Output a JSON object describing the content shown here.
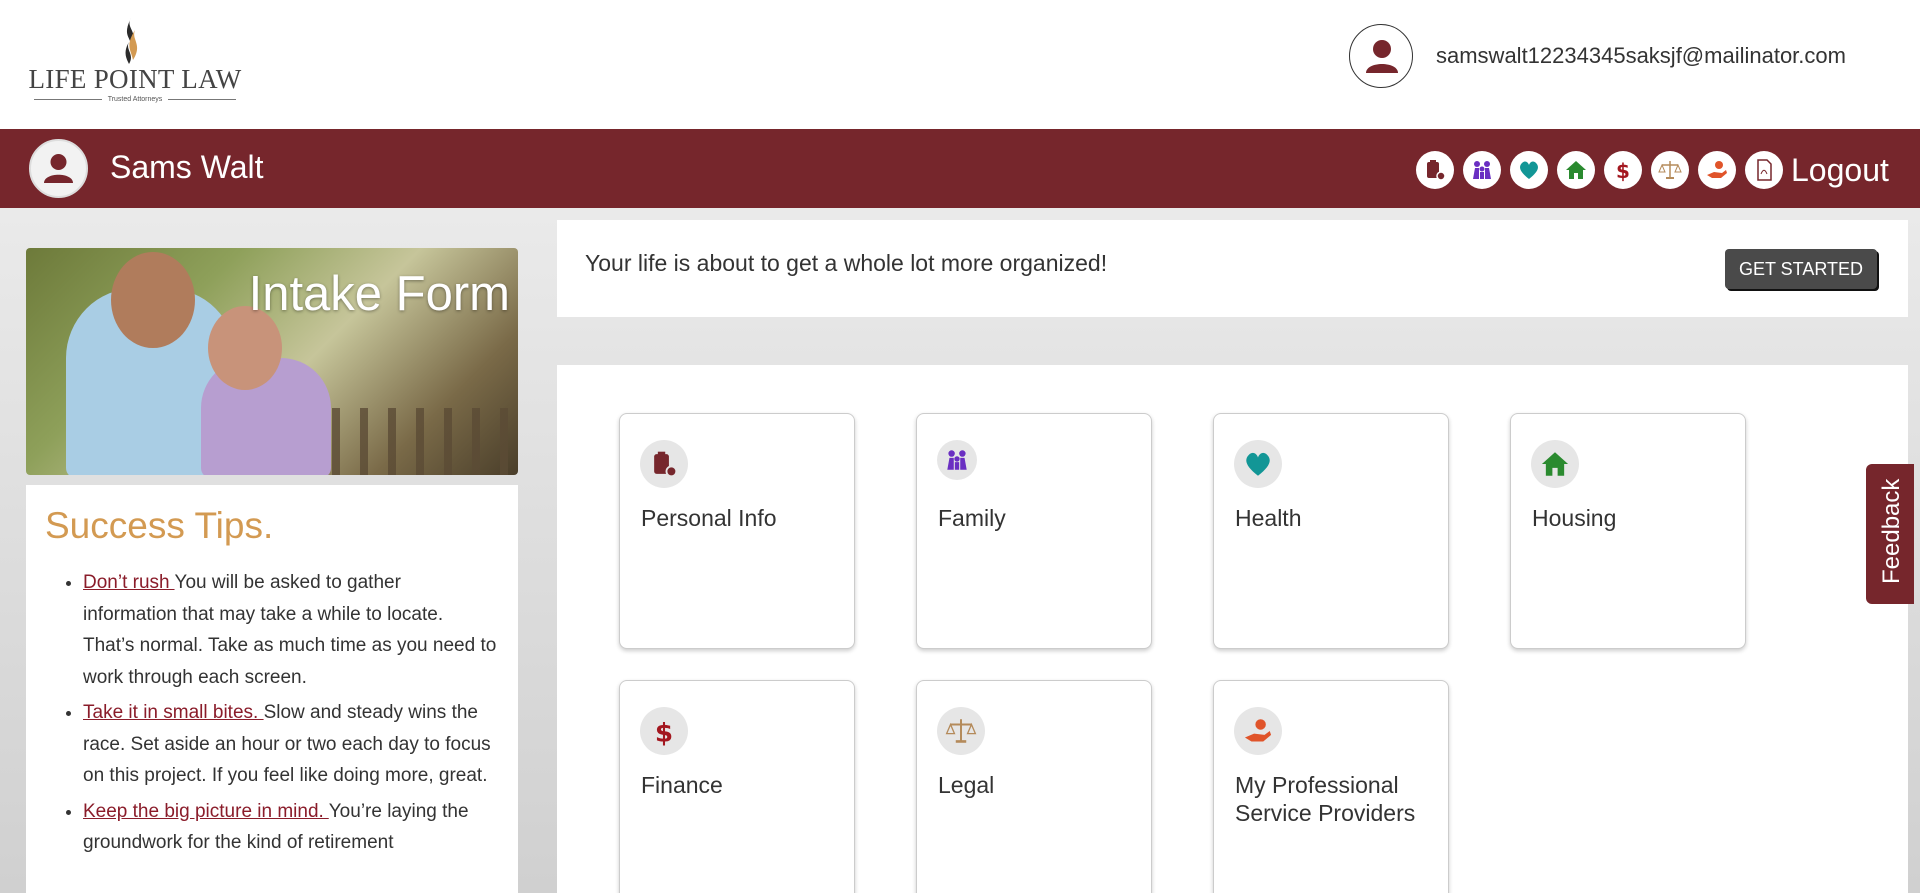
{
  "header": {
    "logo_text": "LIFE POINT LAW",
    "logo_tagline": "Trusted Attorneys",
    "email": "samswalt12234345saksjf@mailinator.com"
  },
  "navbar": {
    "user_name": "Sams Walt",
    "logout_label": "Logout",
    "icons": [
      "clipboard-gear-icon",
      "family-icon",
      "heart-icon",
      "house-icon",
      "dollar-icon",
      "scales-icon",
      "hand-gear-icon",
      "pdf-icon"
    ]
  },
  "hero": {
    "title": "Intake Form"
  },
  "tips": {
    "heading": "Success Tips.",
    "items": [
      {
        "link": "Don’t rush ",
        "text": "You will be asked to gather information that may take a while to locate. That’s normal. Take as much time as you need to work through each screen."
      },
      {
        "link": "Take it in small bites. ",
        "text": "Slow and steady wins the race. Set aside an hour or two each day to focus on this project. If you feel like doing more, great."
      },
      {
        "link": "Keep the big picture in mind. ",
        "text": "You’re laying the groundwork for the kind of retirement"
      }
    ]
  },
  "welcome": {
    "message": "Your life is about to get a whole lot more organized!",
    "button": "GET STARTED"
  },
  "cards": [
    {
      "label": "Personal Info",
      "icon": "clipboard-gear-icon"
    },
    {
      "label": "Family",
      "icon": "family-icon"
    },
    {
      "label": "Health",
      "icon": "heart-icon"
    },
    {
      "label": "Housing",
      "icon": "house-icon"
    },
    {
      "label": "Finance",
      "icon": "dollar-icon"
    },
    {
      "label": "Legal",
      "icon": "scales-icon"
    },
    {
      "label": "My Professional Service Providers",
      "icon": "hand-gear-icon"
    }
  ],
  "feedback": {
    "label": "Feedback"
  },
  "colors": {
    "brand": "#76262c",
    "accent": "#d39a52",
    "link": "#8a1c2a"
  }
}
